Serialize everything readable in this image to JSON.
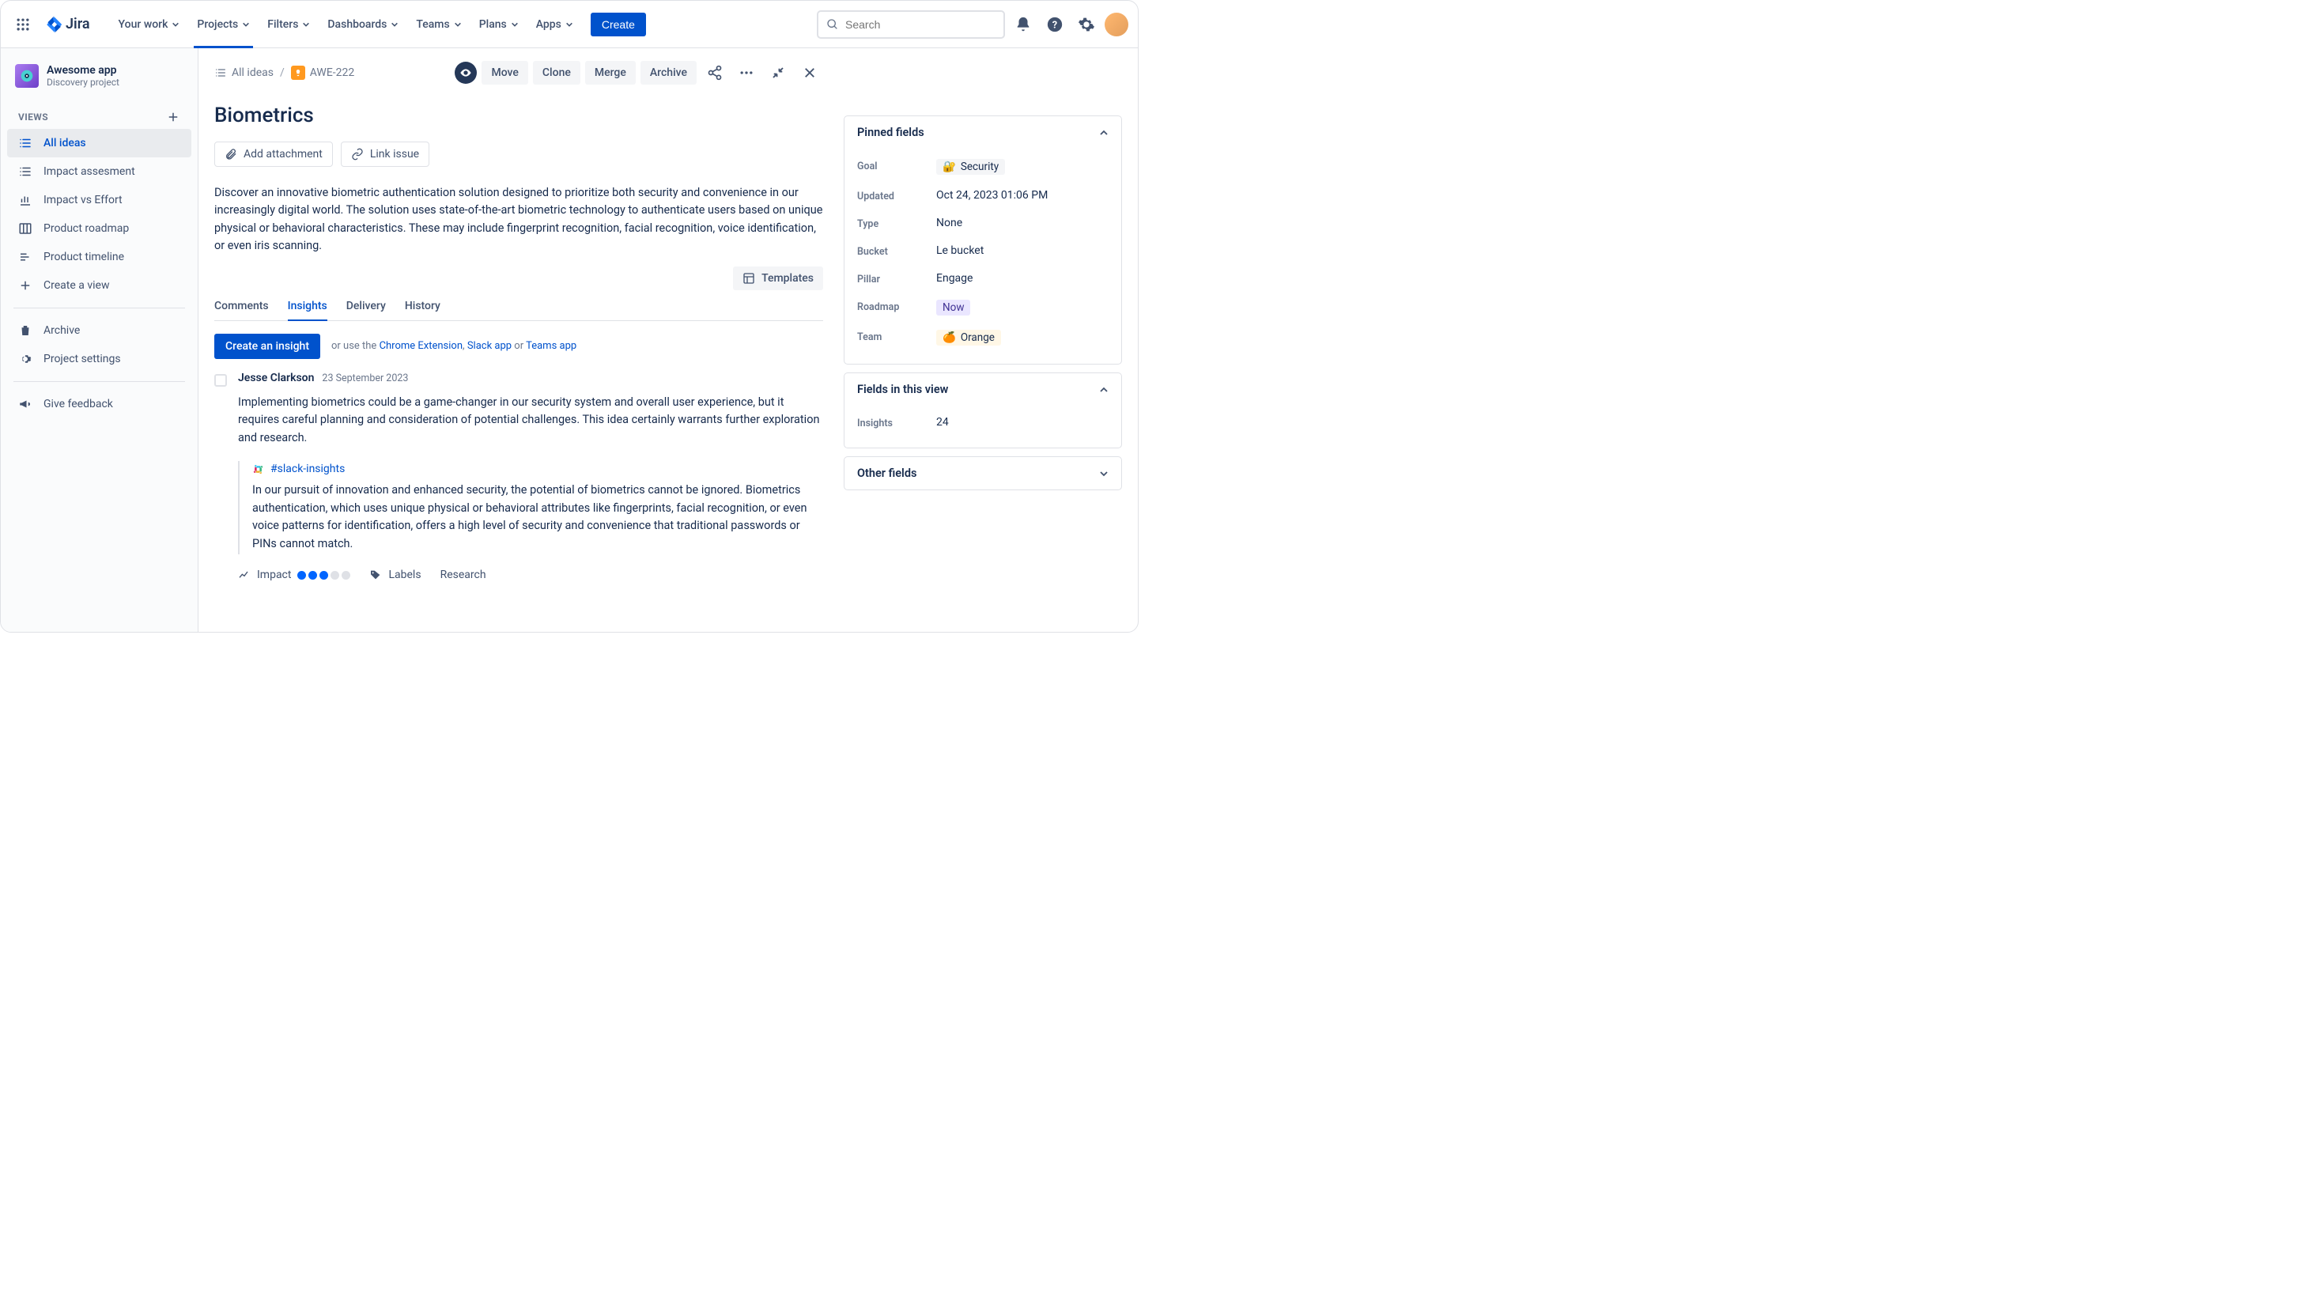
{
  "topnav": {
    "logo_text": "Jira",
    "items": [
      "Your work",
      "Projects",
      "Filters",
      "Dashboards",
      "Teams",
      "Plans",
      "Apps"
    ],
    "active_index": 1,
    "create_label": "Create",
    "search_placeholder": "Search"
  },
  "sidebar": {
    "project_name": "Awesome app",
    "project_subtitle": "Discovery project",
    "views_label": "VIEWS",
    "items": [
      {
        "label": "All ideas",
        "selected": true
      },
      {
        "label": "Impact assesment",
        "selected": false
      },
      {
        "label": "Impact vs Effort",
        "selected": false
      },
      {
        "label": "Product roadmap",
        "selected": false
      },
      {
        "label": "Product timeline",
        "selected": false
      },
      {
        "label": "Create a view",
        "selected": false
      }
    ],
    "archive_label": "Archive",
    "settings_label": "Project settings",
    "feedback_label": "Give feedback"
  },
  "detail": {
    "breadcrumb_root": "All ideas",
    "issue_key": "AWE-222",
    "actions": {
      "move": "Move",
      "clone": "Clone",
      "merge": "Merge",
      "archive": "Archive"
    },
    "title": "Biometrics",
    "add_attachment": "Add attachment",
    "link_issue": "Link issue",
    "description": "Discover an innovative biometric authentication solution designed to prioritize both security and convenience in our increasingly digital world. The solution uses state-of-the-art biometric technology to authenticate users based on unique physical or behavioral characteristics. These may include fingerprint recognition, facial recognition, voice identification, or even iris scanning.",
    "templates_label": "Templates",
    "tabs": [
      "Comments",
      "Insights",
      "Delivery",
      "History"
    ],
    "active_tab": 1,
    "create_insight": "Create an insight",
    "helper_prefix": "or use the ",
    "helper_link1": "Chrome Extension",
    "helper_sep1": ", ",
    "helper_link2": "Slack app",
    "helper_sep2": " or ",
    "helper_link3": "Teams app",
    "insight": {
      "author": "Jesse Clarkson",
      "date": "23 September 2023",
      "text": "Implementing biometrics could be a game-changer in our security system and overall user experience, but it requires careful planning and consideration of potential challenges. This idea certainly warrants further exploration and research.",
      "slack_channel": "#slack-insights",
      "slack_quote": "In our pursuit of innovation and enhanced security, the potential of biometrics cannot be ignored. Biometrics authentication, which uses unique physical or behavioral attributes like fingerprints, facial recognition, or even voice patterns for identification, offers a high level of security and convenience that traditional passwords or PINs cannot match.",
      "impact_label": "Impact",
      "labels_label": "Labels",
      "research_label": "Research"
    }
  },
  "panel": {
    "pinned_title": "Pinned fields",
    "fields": [
      {
        "label": "Goal",
        "value": "Security",
        "type": "security"
      },
      {
        "label": "Updated",
        "value": "Oct 24, 2023 01:06 PM"
      },
      {
        "label": "Type",
        "value": "None"
      },
      {
        "label": "Bucket",
        "value": "Le bucket"
      },
      {
        "label": "Pillar",
        "value": "Engage"
      },
      {
        "label": "Roadmap",
        "value": "Now",
        "type": "now"
      },
      {
        "label": "Team",
        "value": "Orange",
        "type": "orange"
      }
    ],
    "view_fields_title": "Fields in this view",
    "insights_label": "Insights",
    "insights_value": "24",
    "other_fields_title": "Other fields"
  }
}
